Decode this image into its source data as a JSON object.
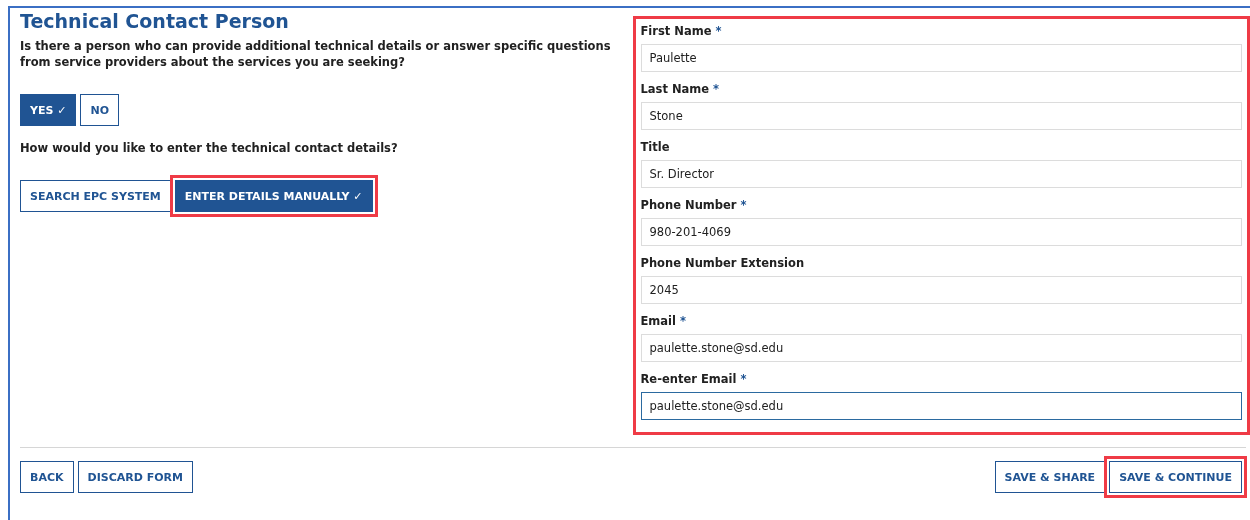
{
  "title": "Technical Contact Person",
  "question_1": "Is there a person who can provide additional technical details or answer specific questions from service providers about the services you are seeking?",
  "answer_1": [
    {
      "label": "YES ✓",
      "selected": true,
      "highlighted": false
    },
    {
      "label": "NO",
      "selected": false,
      "highlighted": false
    }
  ],
  "question_2": "How would you like to enter the technical contact details?",
  "answer_2": [
    {
      "label": "SEARCH EPC SYSTEM",
      "selected": false,
      "highlighted": false
    },
    {
      "label": "ENTER DETAILS MANUALLY ✓",
      "selected": true,
      "highlighted": true
    }
  ],
  "form": {
    "highlighted": true,
    "fields": [
      {
        "label": "First Name",
        "required_mark": "*",
        "value": "Paulette",
        "focused": false
      },
      {
        "label": "Last Name",
        "required_mark": "*",
        "value": "Stone",
        "focused": false
      },
      {
        "label": "Title",
        "value": "Sr. Director",
        "focused": false
      },
      {
        "label": "Phone Number",
        "required_mark": "*",
        "value": "980-201-4069",
        "focused": false
      },
      {
        "label": "Phone Number Extension",
        "value": "2045",
        "focused": false
      },
      {
        "label": "Email",
        "required_mark": "*",
        "value": "paulette.stone@sd.edu",
        "focused": false
      },
      {
        "label": "Re-enter Email",
        "required_mark": "*",
        "value": "paulette.stone@sd.edu",
        "focused": true
      }
    ]
  },
  "footer": {
    "left_buttons": [
      {
        "label": "BACK",
        "highlighted": false
      },
      {
        "label": "DISCARD FORM",
        "highlighted": false
      }
    ],
    "right_buttons": [
      {
        "label": "SAVE & SHARE",
        "highlighted": false
      },
      {
        "label": "SAVE & CONTINUE",
        "highlighted": true
      }
    ]
  }
}
